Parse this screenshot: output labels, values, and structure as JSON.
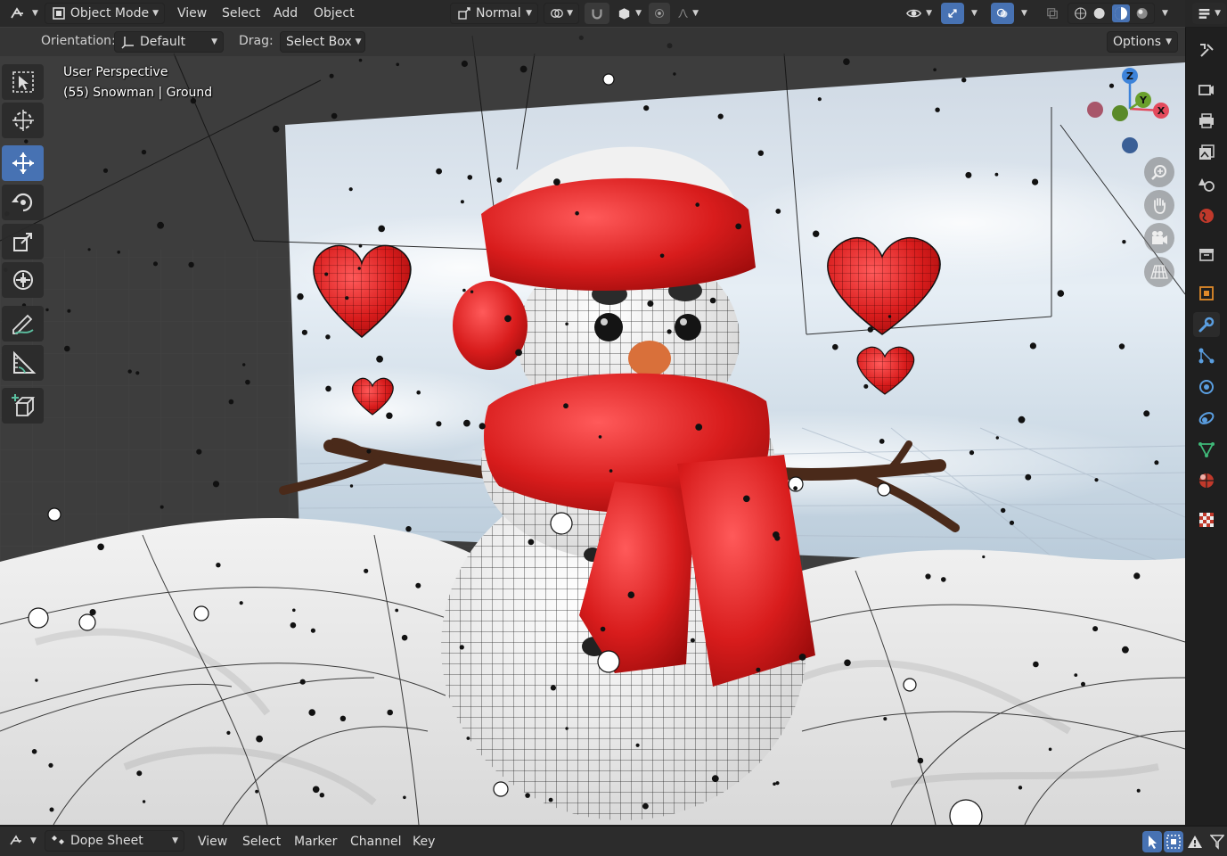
{
  "header": {
    "mode_label": "Object Mode",
    "menus": [
      "View",
      "Select",
      "Add",
      "Object"
    ],
    "transform_orientation": "Normal",
    "options_label": "Options"
  },
  "tool_settings": {
    "orientation_label": "Orientation:",
    "orientation_value": "Default",
    "drag_label": "Drag:",
    "drag_value": "Select Box"
  },
  "viewport": {
    "view_name": "User Perspective",
    "object_info": "(55) Snowman | Ground",
    "gizmo": {
      "z": "Z",
      "y": "Y",
      "x": "X"
    }
  },
  "toolbar": {
    "tools": [
      "select-box",
      "cursor",
      "move",
      "rotate",
      "scale",
      "transform",
      "annotate",
      "measure",
      "add-cube"
    ],
    "active_tool": "move"
  },
  "properties_tabs": [
    "tool",
    "render",
    "output",
    "view-layer",
    "scene",
    "world",
    "collection",
    "object",
    "modifiers",
    "particles",
    "physics",
    "constraints",
    "data",
    "material",
    "texture"
  ],
  "active_properties_tab": "modifiers",
  "bottom_bar": {
    "editor_label": "Dope Sheet",
    "menus": [
      "View",
      "Select",
      "Marker",
      "Channel",
      "Key"
    ]
  },
  "colors": {
    "accent": "#4772b3",
    "axis_x": "#e34a5c",
    "axis_y": "#6aa02c",
    "axis_z": "#3d83d9"
  }
}
